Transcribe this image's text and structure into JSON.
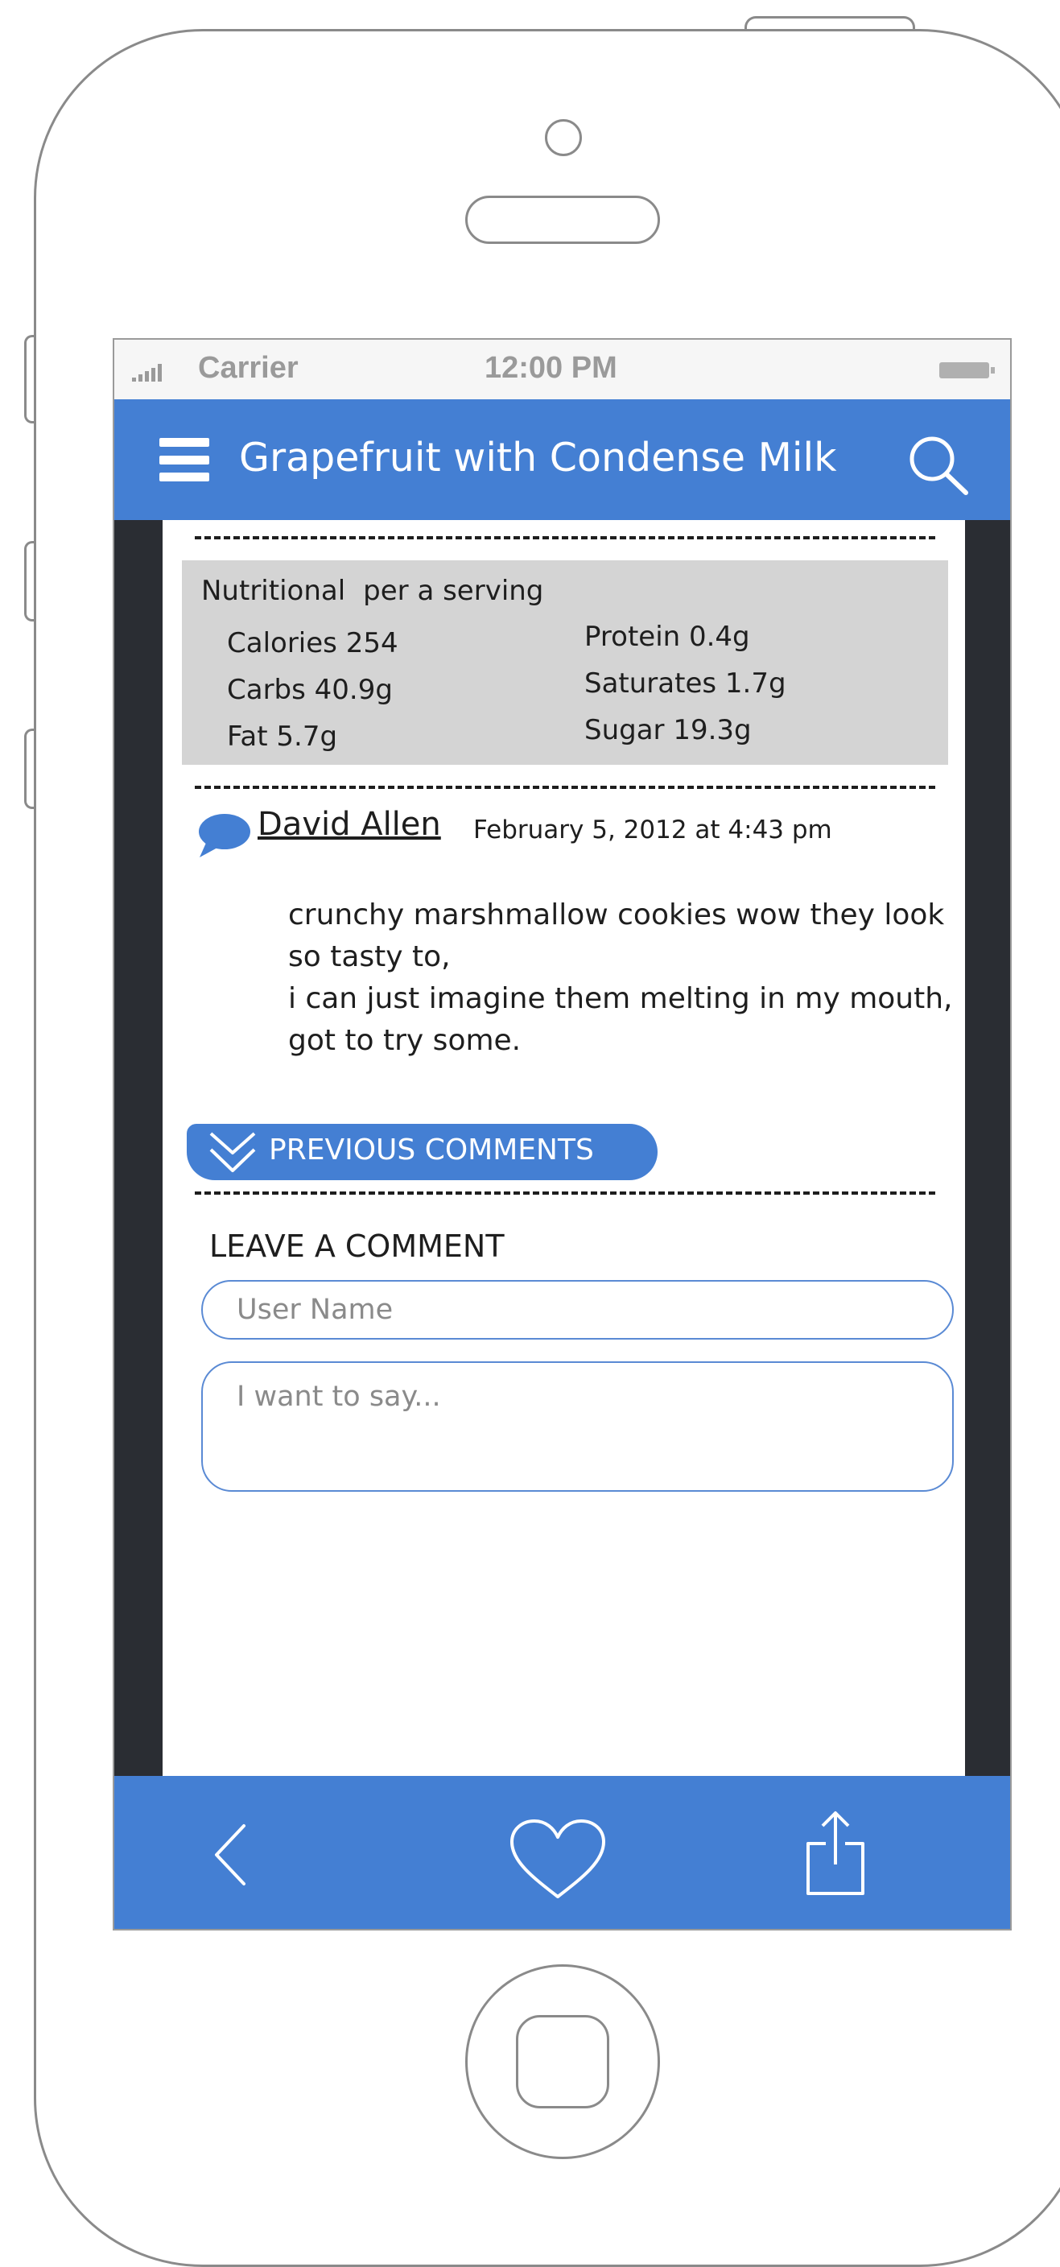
{
  "status_bar": {
    "carrier": "Carrier",
    "time": "12:00 PM"
  },
  "nav": {
    "title": "Grapefruit with Condense Milk",
    "menu_icon": "hamburger-icon",
    "search_icon": "search-icon"
  },
  "nutrition": {
    "heading": "Nutritional",
    "subheading": "per a serving",
    "left": [
      "Calories 254",
      "Carbs 40.9g",
      "Fat 5.7g"
    ],
    "right": [
      "Protein 0.4g",
      "Saturates 1.7g",
      "Sugar 19.3g"
    ]
  },
  "comment": {
    "author": "David Allen",
    "date": "February 5, 2012 at 4:43 pm",
    "lines": [
      "crunchy marshmallow cookies wow they look",
      "so tasty to,",
      "i can just imagine them melting in my mouth,",
      "got to try some."
    ]
  },
  "previous_comments_label": "PREVIOUS COMMENTS",
  "leave_comment": {
    "title": "LEAVE A COMMENT",
    "username_placeholder": "User Name",
    "message_placeholder": "I want to say..."
  },
  "tab_bar": {
    "icons": [
      "back-icon",
      "heart-icon",
      "share-icon"
    ]
  },
  "colors": {
    "accent": "#447fd3",
    "screen_border": "#2a2d33",
    "nutrition_bg": "#d4d4d4"
  }
}
